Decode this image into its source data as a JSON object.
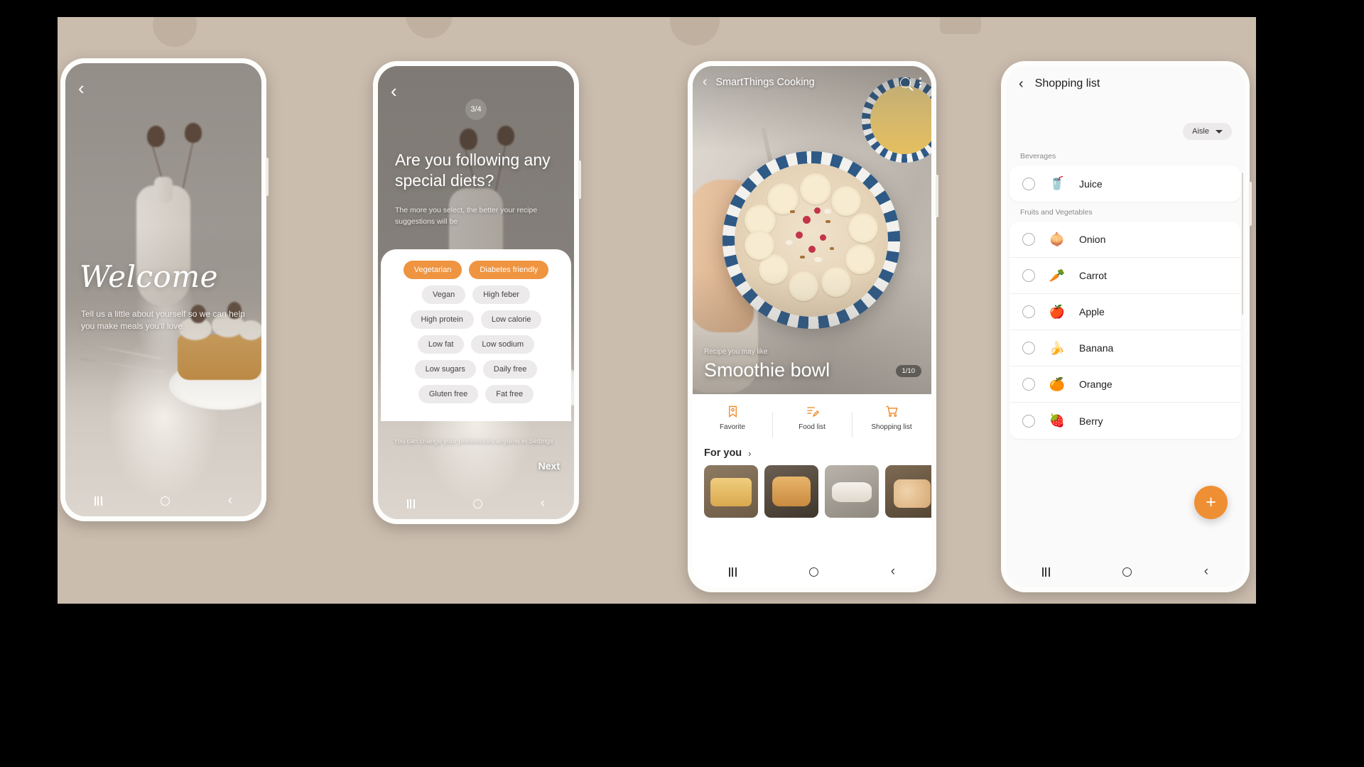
{
  "backdrop": {
    "color": "#cbbdae"
  },
  "accent": "#ef8f33",
  "phone1": {
    "back_icon": "‹",
    "title": "Welcome",
    "subtitle": "Tell us a little about yourself so we can help you make meals you'll love."
  },
  "phone2": {
    "back_icon": "‹",
    "page_indicator": "3/4",
    "question": "Are you following any special diets?",
    "hint": "The more you select, the better your recipe suggestions will be",
    "chips": [
      {
        "label": "Vegetarian",
        "selected": true
      },
      {
        "label": "Diabetes  friendly",
        "selected": true
      },
      {
        "label": "Vegan",
        "selected": false
      },
      {
        "label": "High feber",
        "selected": false
      },
      {
        "label": "High protein",
        "selected": false
      },
      {
        "label": "Low calorie",
        "selected": false
      },
      {
        "label": "Low fat",
        "selected": false
      },
      {
        "label": "Low sodium",
        "selected": false
      },
      {
        "label": "Low sugars",
        "selected": false
      },
      {
        "label": "Daily free",
        "selected": false
      },
      {
        "label": "Gluten free",
        "selected": false
      },
      {
        "label": "Fat free",
        "selected": false
      }
    ],
    "footer_note": "You can change your preferences anytime in Settings",
    "next_label": "Next"
  },
  "phone3": {
    "back_icon": "‹",
    "app_title": "SmartThings Cooking",
    "search_icon": "search-icon",
    "more_icon": "overflow-menu-icon",
    "hero_kicker": "Recipe you may like",
    "hero_title": "Smoothie bowl",
    "hero_count": "1/10",
    "actions": [
      {
        "label": "Favorite",
        "icon": "bookmark-icon"
      },
      {
        "label": "Food list",
        "icon": "food-list-icon"
      },
      {
        "label": "Shopping list",
        "icon": "cart-icon"
      }
    ],
    "section_label": "For you",
    "section_arrow": "›",
    "thumbnails": [
      {
        "name": "cornbread-thumbnail"
      },
      {
        "name": "braised-chicken-thumbnail"
      },
      {
        "name": "pastry-plate-thumbnail"
      },
      {
        "name": "eggs-basket-thumbnail"
      }
    ]
  },
  "phone4": {
    "back_icon": "‹",
    "title": "Shopping list",
    "sort_label": "Aisle",
    "groups": [
      {
        "name": "Beverages",
        "items": [
          {
            "label": "Juice",
            "emoji": "🥤",
            "checked": false
          }
        ]
      },
      {
        "name": "Fruits and Vegetables",
        "items": [
          {
            "label": "Onion",
            "emoji": "🧅",
            "checked": false
          },
          {
            "label": "Carrot",
            "emoji": "🥕",
            "checked": false
          },
          {
            "label": "Apple",
            "emoji": "🍎",
            "checked": false
          },
          {
            "label": "Banana",
            "emoji": "🍌",
            "checked": false
          },
          {
            "label": "Orange",
            "emoji": "🍊",
            "checked": false
          },
          {
            "label": "Berry",
            "emoji": "🍓",
            "checked": false
          }
        ]
      }
    ],
    "add_label": "+"
  },
  "navbar": {
    "recents": "|||",
    "home": "home-icon",
    "back": "‹"
  }
}
